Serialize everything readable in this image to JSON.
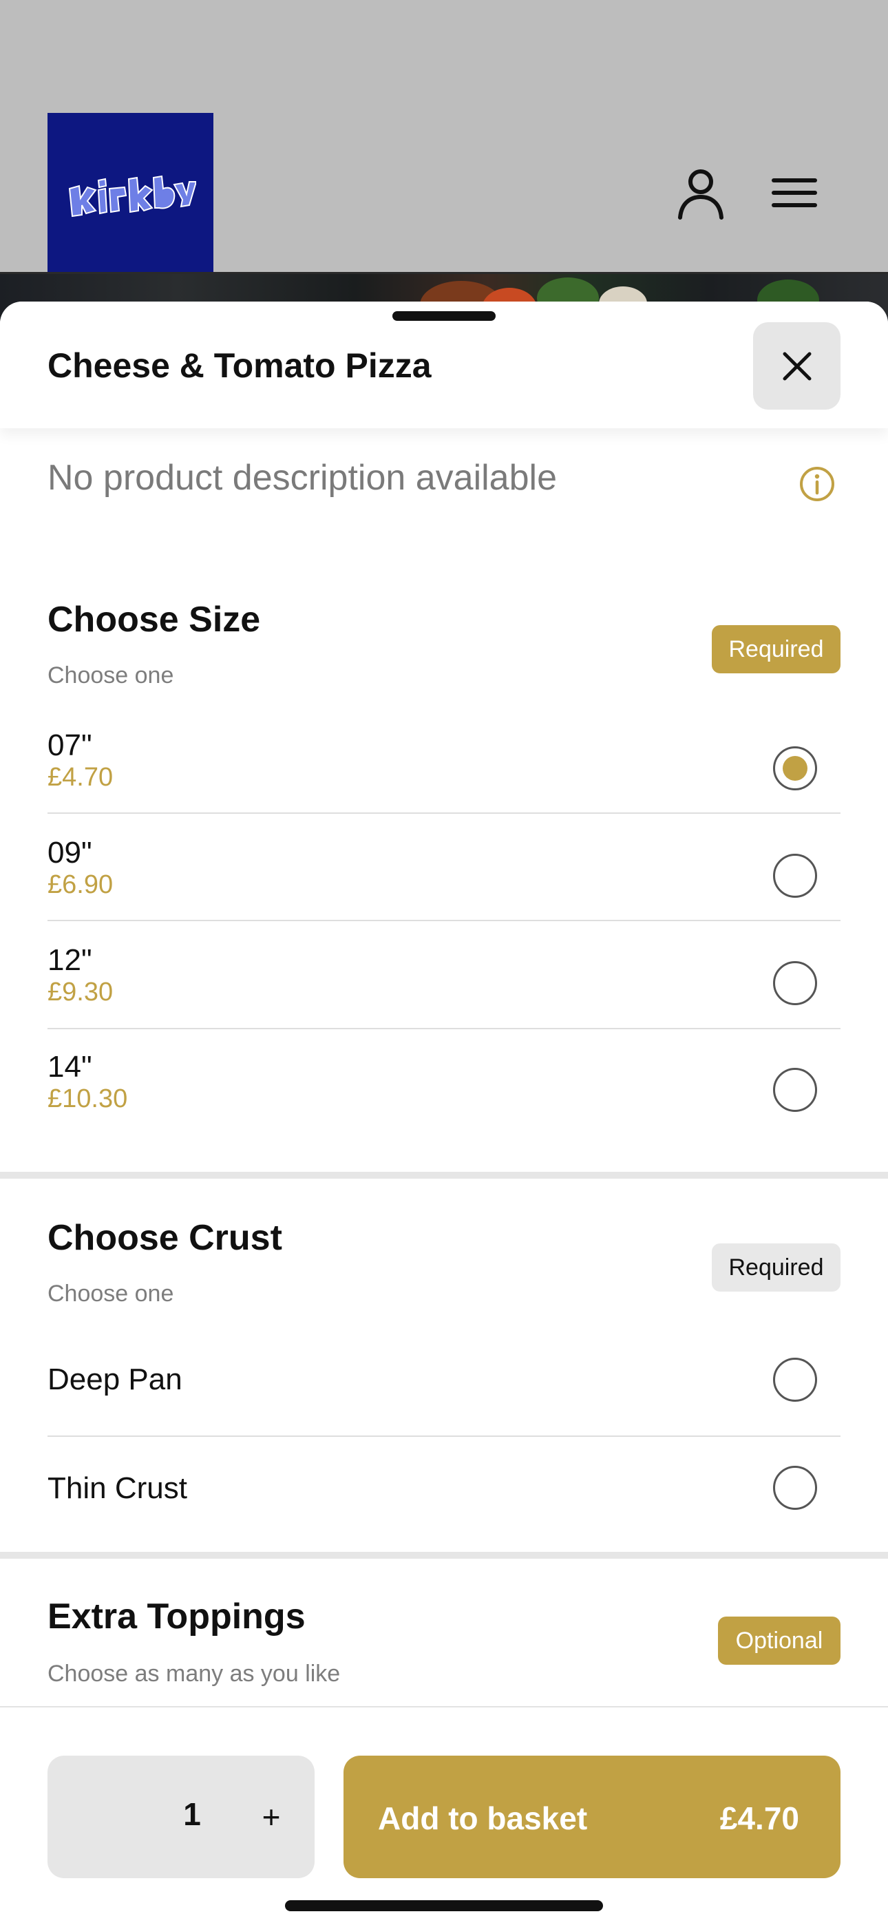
{
  "product": {
    "title": "Cheese & Tomato Pizza",
    "description": "No product description available"
  },
  "sections": {
    "size": {
      "title": "Choose Size",
      "subtitle": "Choose one",
      "badge": "Required",
      "options": [
        {
          "name": "07\"",
          "price": "£4.70",
          "selected": true
        },
        {
          "name": "09\"",
          "price": "£6.90",
          "selected": false
        },
        {
          "name": "12\"",
          "price": "£9.30",
          "selected": false
        },
        {
          "name": "14\"",
          "price": "£10.30",
          "selected": false
        }
      ]
    },
    "crust": {
      "title": "Choose Crust",
      "subtitle": "Choose one",
      "badge": "Required",
      "options": [
        {
          "name": "Deep Pan",
          "selected": false
        },
        {
          "name": "Thin Crust",
          "selected": false
        }
      ]
    },
    "toppings": {
      "title": "Extra Toppings",
      "subtitle": "Choose as many as you like",
      "badge": "Optional"
    }
  },
  "footer": {
    "quantity": "1",
    "plus_label": "+",
    "add_label": "Add to basket",
    "add_price": "£4.70"
  },
  "colors": {
    "accent": "#c1a144",
    "logo_bg": "#0d1781"
  },
  "icons": {
    "account": "user-icon",
    "menu": "hamburger-menu-icon",
    "close": "close-icon",
    "info": "info-icon"
  }
}
